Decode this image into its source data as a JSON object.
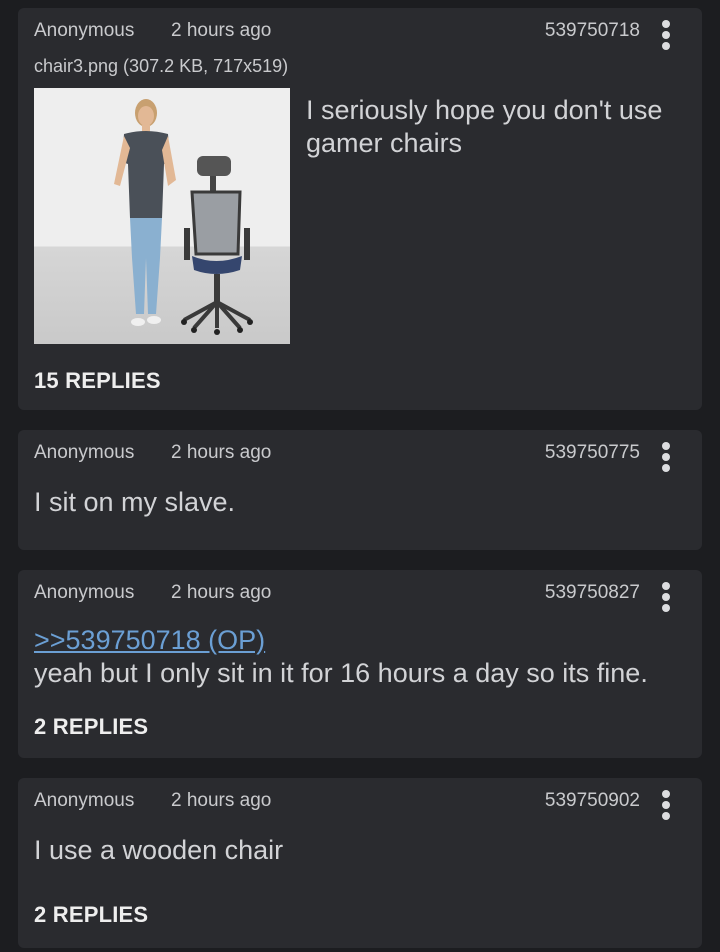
{
  "posts": [
    {
      "author": "Anonymous",
      "time": "2 hours ago",
      "id": "539750718",
      "file_info": "chair3.png (307.2 KB, 717x519)",
      "text": "I seriously hope you don't use gamer chairs",
      "replies": "15 REPLIES"
    },
    {
      "author": "Anonymous",
      "time": "2 hours ago",
      "id": "539750775",
      "text": "I sit on my slave."
    },
    {
      "author": "Anonymous",
      "time": "2 hours ago",
      "id": "539750827",
      "quote": ">>539750718 (OP)",
      "text": "yeah but I only sit in it for 16 hours a day so its fine.",
      "replies": "2 REPLIES"
    },
    {
      "author": "Anonymous",
      "time": "2 hours ago",
      "id": "539750902",
      "text": "I use a wooden chair",
      "replies": "2 REPLIES"
    }
  ],
  "colors": {
    "background": "#1c1d20",
    "card": "#2a2b2f",
    "text": "#d2d3d6",
    "quote_link": "#6b9fd4"
  },
  "icons": {
    "menu": "more-vertical-icon"
  }
}
